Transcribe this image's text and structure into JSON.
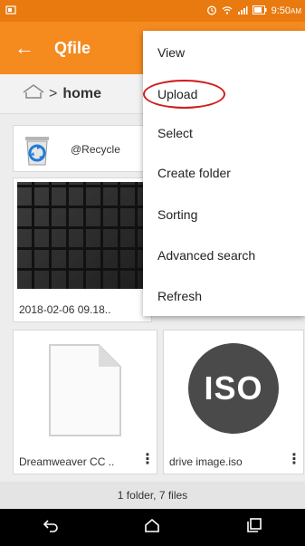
{
  "status_bar": {
    "time": "9:50",
    "ampm": "AM"
  },
  "app_bar": {
    "title": "Qfile"
  },
  "breadcrumb": {
    "separator": ">",
    "current": "home"
  },
  "files": [
    {
      "name": "@Recycle"
    },
    {
      "name": "2018-02-06 09.18.."
    },
    {
      "name": "Dreamweaver CC .."
    },
    {
      "name": "drive image.iso",
      "iso_text": "ISO"
    }
  ],
  "menu": {
    "items": [
      {
        "label": "View"
      },
      {
        "label": "Upload"
      },
      {
        "label": "Select"
      },
      {
        "label": "Create folder"
      },
      {
        "label": "Sorting"
      },
      {
        "label": "Advanced search"
      },
      {
        "label": "Refresh"
      }
    ]
  },
  "footer": {
    "count": "1 folder, 7 files"
  },
  "colors": {
    "accent": "#f58a1f",
    "status_bar": "#e87a10",
    "highlight_ring": "#d11b1b"
  }
}
